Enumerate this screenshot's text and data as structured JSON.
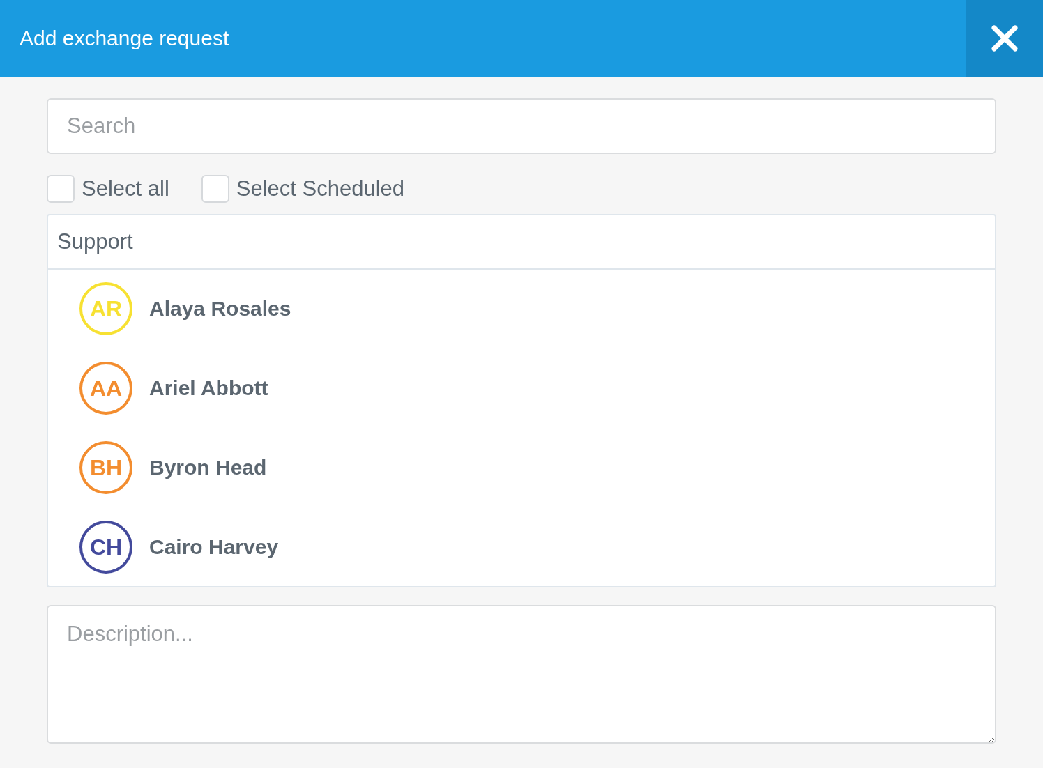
{
  "window": {
    "title": "Add exchange request"
  },
  "search": {
    "placeholder": "Search"
  },
  "filters": [
    {
      "label": "Select all",
      "checked": false
    },
    {
      "label": "Select Scheduled",
      "checked": false
    }
  ],
  "group": {
    "title": "Support",
    "people": [
      {
        "initials": "AR",
        "name": "Alaya Rosales",
        "color": "#f7e132"
      },
      {
        "initials": "AA",
        "name": "Ariel Abbott",
        "color": "#f38d2f"
      },
      {
        "initials": "BH",
        "name": "Byron Head",
        "color": "#f38d2f"
      },
      {
        "initials": "CH",
        "name": "Cairo Harvey",
        "color": "#434a9c"
      }
    ]
  },
  "description": {
    "placeholder": "Description..."
  }
}
